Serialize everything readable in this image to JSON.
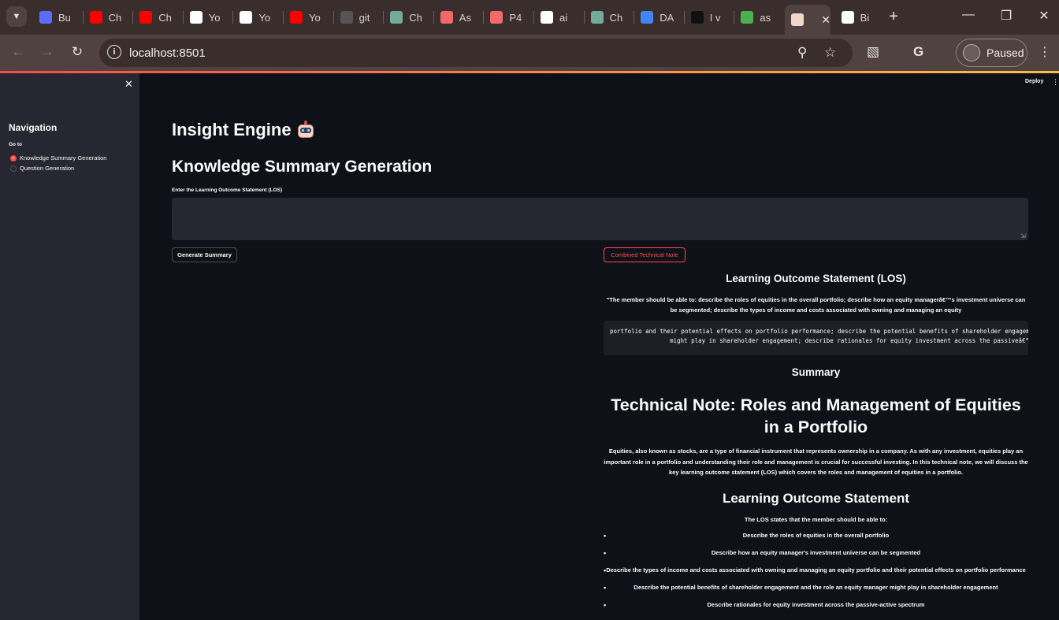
{
  "browser": {
    "tabs": [
      {
        "title": "Bu",
        "icon": "hexagon-icon",
        "color": "#5b6cff"
      },
      {
        "title": "Ch",
        "icon": "youtube-icon",
        "color": "#ff0000"
      },
      {
        "title": "Ch",
        "icon": "youtube-icon",
        "color": "#ff0000"
      },
      {
        "title": "Yo",
        "icon": "github-icon",
        "color": "#ffffff"
      },
      {
        "title": "Yo",
        "icon": "github-icon",
        "color": "#ffffff"
      },
      {
        "title": "Yo",
        "icon": "youtube-icon",
        "color": "#ff0000"
      },
      {
        "title": "git",
        "icon": "github-icon",
        "color": "#555555"
      },
      {
        "title": "Ch",
        "icon": "chatgpt-icon",
        "color": "#74aa9c"
      },
      {
        "title": "As",
        "icon": "asana-icon",
        "color": "#f06a6a"
      },
      {
        "title": "P4",
        "icon": "asana-icon",
        "color": "#f06a6a"
      },
      {
        "title": "ai",
        "icon": "google-icon",
        "color": "#ffffff"
      },
      {
        "title": "Ch",
        "icon": "chatgpt-icon",
        "color": "#74aa9c"
      },
      {
        "title": "DA",
        "icon": "docs-icon",
        "color": "#4285f4"
      },
      {
        "title": "I v",
        "icon": "dark-logo-icon",
        "color": "#111111"
      },
      {
        "title": "as",
        "icon": "green-app-icon",
        "color": "#4caf50"
      },
      {
        "title": "",
        "icon": "streamlit-icon",
        "color": "#f3d6c8",
        "active": true
      },
      {
        "title": "Bi",
        "icon": "github-icon",
        "color": "#ffffff"
      }
    ],
    "url": "localhost:8501",
    "profile_label": "Paused"
  },
  "app": {
    "deploy_label": "Deploy",
    "sidebar": {
      "title": "Navigation",
      "goto_label": "Go to",
      "options": [
        {
          "label": "Knowledge Summary Generation",
          "selected": true
        },
        {
          "label": "Question Generation",
          "selected": false
        }
      ]
    },
    "title": "Insight Engine",
    "page_heading": "Knowledge Summary Generation",
    "input_label": "Enter the Learning Outcome Statement (LOS)",
    "input_value": "",
    "generate_button": "Generate Summary",
    "combined_button": "Combined Technical Note",
    "output": {
      "los_heading": "Learning Outcome Statement (LOS)",
      "los_text": "\"The member should be able to: describe the roles of equities in the overall portfolio; describe how an equity managerâ€™s investment universe can be segmented; describe the types of income and costs associated with owning and managing an equity",
      "code_line_1": "portfolio and their potential effects on portfolio performance; describe the potential benefits of shareholder engagemen",
      "code_line_2": "might play in shareholder engagement; describe rationales for equity investment across the passiveâ€“ac",
      "summary_heading": "Summary",
      "tech_note_title": "Technical Note: Roles and Management of Equities in a Portfolio",
      "intro_text": "Equities, also known as stocks, are a type of financial instrument that represents ownership in a company. As with any investment, equities play an important role in a portfolio and understanding their role and management is crucial for successful investing. In this technical note, we will discuss the key learning outcome statement (LOS) which covers the roles and management of equities in a portfolio.",
      "los_section_heading": "Learning Outcome Statement",
      "los_section_intro": "The LOS states that the member should be able to:",
      "bullets": [
        "Describe the roles of equities in the overall portfolio",
        "Describe how an equity manager's investment universe can be segmented",
        "Describe the types of income and costs associated with owning and managing an equity portfolio and their potential effects on portfolio performance",
        "Describe the potential benefits of shareholder engagement and the role an equity manager might play in shareholder engagement",
        "Describe rationales for equity investment across the passive-active spectrum"
      ]
    }
  }
}
